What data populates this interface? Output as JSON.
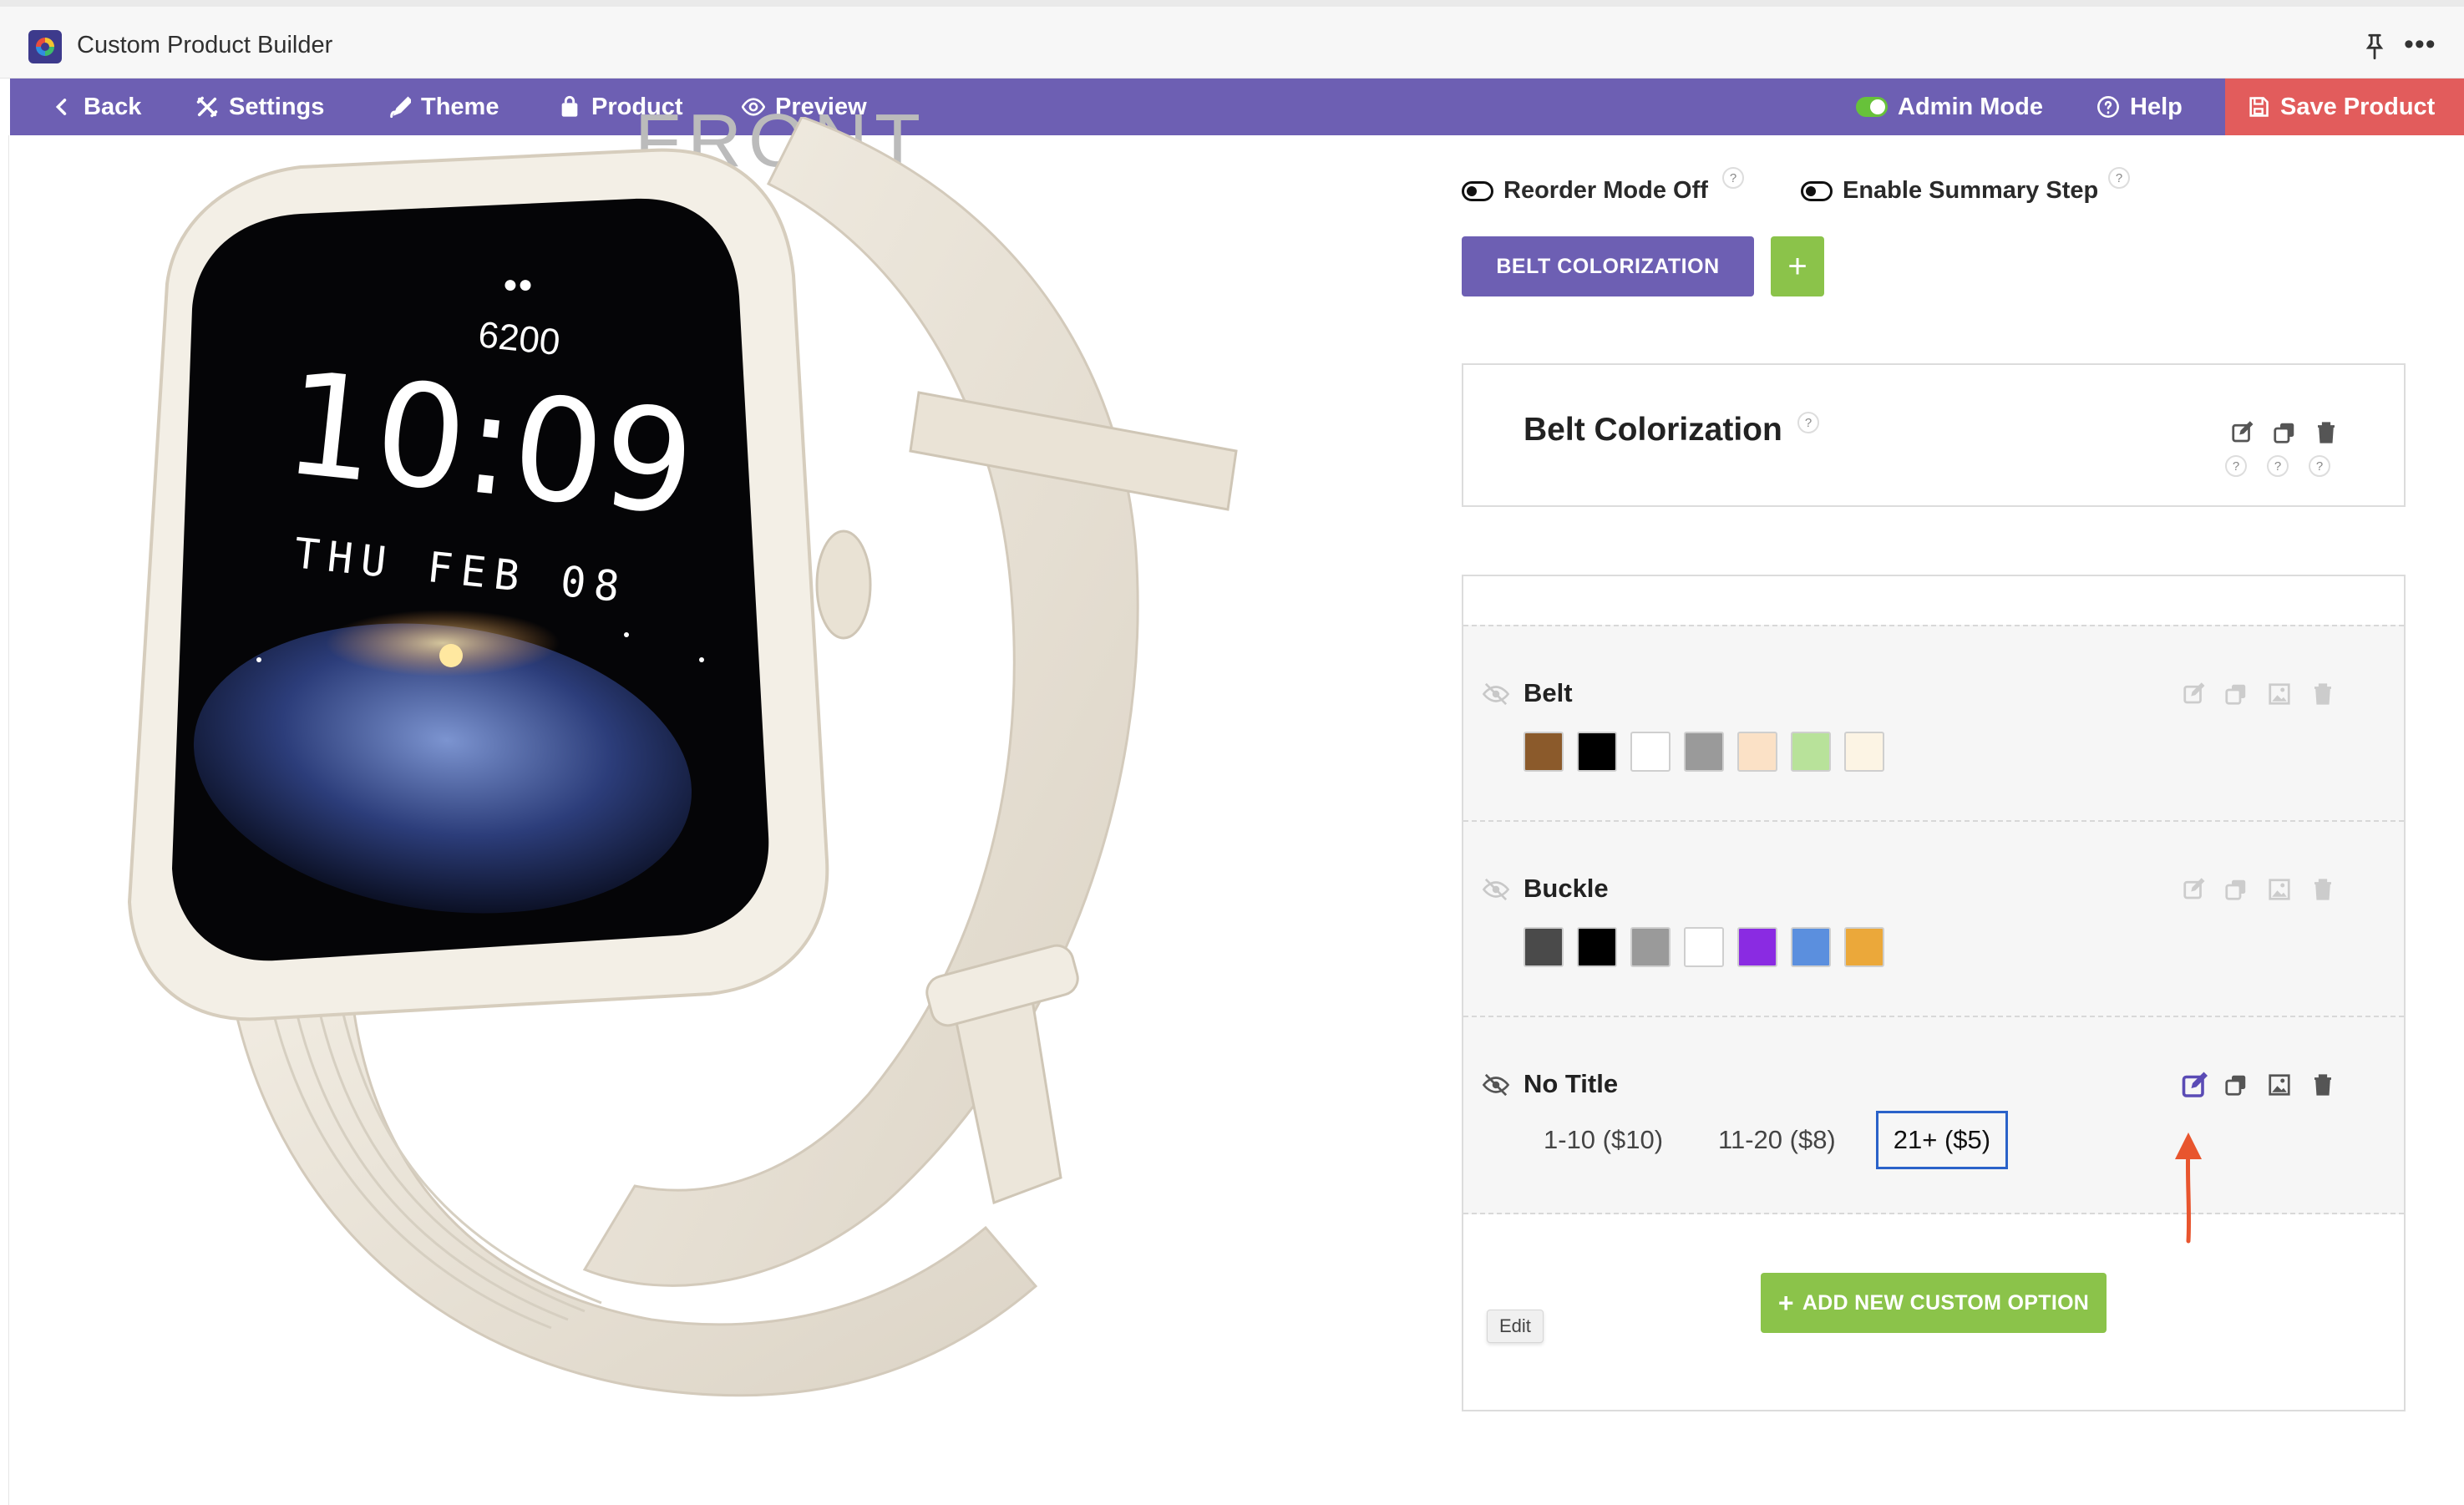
{
  "window": {
    "title": "Custom Product Builder",
    "more": "•••"
  },
  "toolbar": {
    "back": "Back",
    "settings": "Settings",
    "theme": "Theme",
    "product": "Product",
    "preview": "Preview",
    "admin_mode": "Admin Mode",
    "help": "Help",
    "save": "Save Product"
  },
  "preview": {
    "view_label": "FRONT",
    "steps_count": "6200",
    "time": "10:09",
    "date": "THU FEB 08"
  },
  "controls": {
    "reorder_mode": "Reorder Mode Off",
    "summary_step": "Enable Summary Step",
    "help_mark": "?"
  },
  "steps": {
    "tabs": [
      "BELT COLORIZATION"
    ],
    "add_symbol": "+"
  },
  "step_card": {
    "title": "Belt Colorization"
  },
  "options": [
    {
      "label": "Belt",
      "swatches": [
        "#8b5a2b",
        "#000000",
        "#ffffff",
        "#9a9a9a",
        "#fbe1c6",
        "#b8e29a",
        "#fcf4e4"
      ]
    },
    {
      "label": "Buckle",
      "swatches": [
        "#4a4a4a",
        "#000000",
        "#9a9a9a",
        "#ffffff",
        "#8a2be2",
        "#5b8fde",
        "#eba83a"
      ]
    },
    {
      "label": "No Title",
      "choices": [
        "1-10 ($10)",
        "11-20 ($8)",
        "21+ ($5)"
      ],
      "selected_index": 2
    }
  ],
  "add_option": {
    "icon": "+",
    "label": "ADD NEW CUSTOM OPTION"
  },
  "tooltip": {
    "text": "Edit"
  },
  "colors": {
    "toolbar": "#6d5fb3",
    "save": "#e25c5c",
    "accent_green": "#8bc34a",
    "selected_border": "#2a62c9",
    "annotation_arrow": "#e8552e"
  }
}
